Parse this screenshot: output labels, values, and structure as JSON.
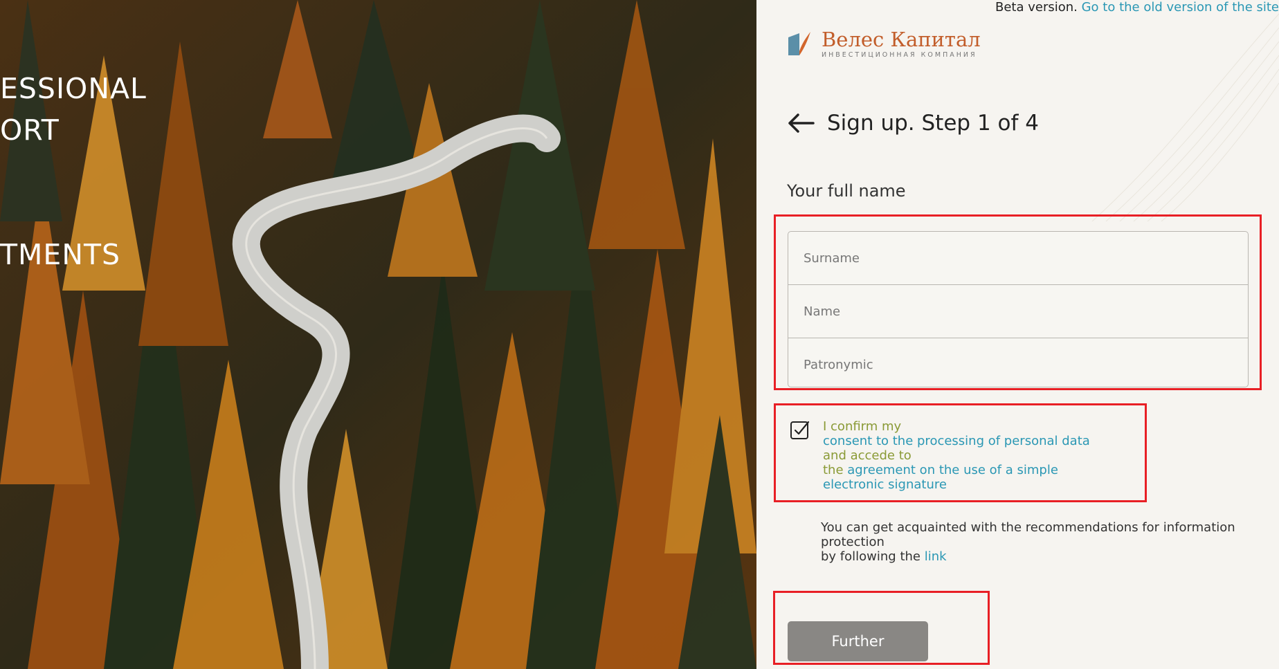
{
  "hero": {
    "line1": "ESSIONAL",
    "line2": "ORT",
    "line3": "TMENTS"
  },
  "topbar": {
    "beta_label": "Beta version.",
    "old_version_link": "Go to the old version of the site"
  },
  "logo": {
    "name": "Велес Капитал",
    "subtitle": "ИНВЕСТИЦИОННАЯ КОМПАНИЯ"
  },
  "form": {
    "title": "Sign up. Step 1 of 4",
    "full_name_label": "Your full name",
    "surname_placeholder": "Surname",
    "name_placeholder": "Name",
    "patronymic_placeholder": "Patronymic",
    "surname_value": "",
    "name_value": "",
    "patronymic_value": "",
    "consent": {
      "checked": true,
      "part1": "I confirm my",
      "link1": "consent to the processing of personal data",
      "part2": "and accede to",
      "part3": "the",
      "link2": "agreement on the use of a simple electronic signature"
    },
    "info": {
      "text1": "You can get acquainted with the recommendations for information protection",
      "text2": "by following the",
      "link": "link"
    },
    "further_label": "Further"
  },
  "colors": {
    "accent_teal": "#2a97b4",
    "olive_text": "#8a9a36",
    "brand_orange": "#c25d2a",
    "highlight_red": "#e81f25",
    "button_gray": "#898784"
  },
  "icons": [
    "back-arrow-icon",
    "checkbox-checked-icon",
    "logo-mark-icon"
  ]
}
